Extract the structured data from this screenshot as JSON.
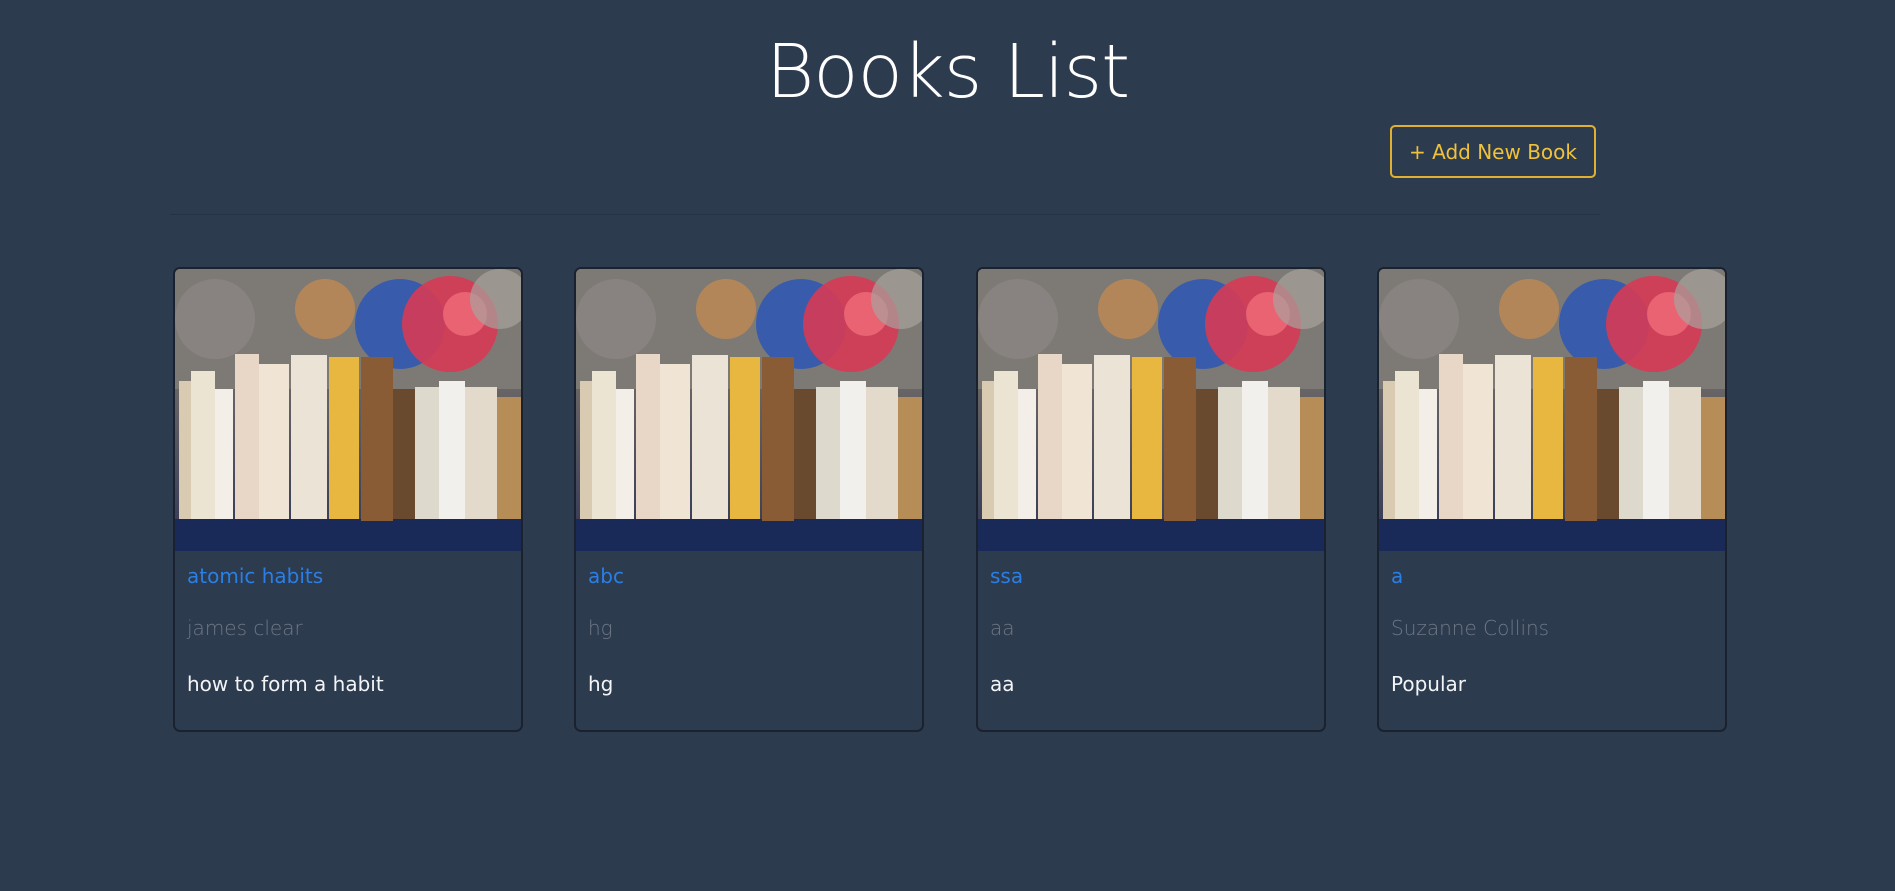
{
  "header": {
    "title": "Books List",
    "add_button_label": "+ Add New Book"
  },
  "books": [
    {
      "title": "atomic habits",
      "author": "james clear",
      "description": "how to form a habit"
    },
    {
      "title": "abc",
      "author": "hg",
      "description": "hg"
    },
    {
      "title": "ssa",
      "author": "aa",
      "description": "aa"
    },
    {
      "title": "a",
      "author": "Suzanne Collins",
      "description": "Popular"
    }
  ],
  "colors": {
    "background": "#2d3b4f",
    "title": "#ffffff",
    "button_accent": "#e0b12f",
    "book_title": "#2a7fe6",
    "book_author": "#6e7785",
    "book_description": "#f3f4f6"
  },
  "icons": {
    "card_image": "book-shelf-photo"
  }
}
